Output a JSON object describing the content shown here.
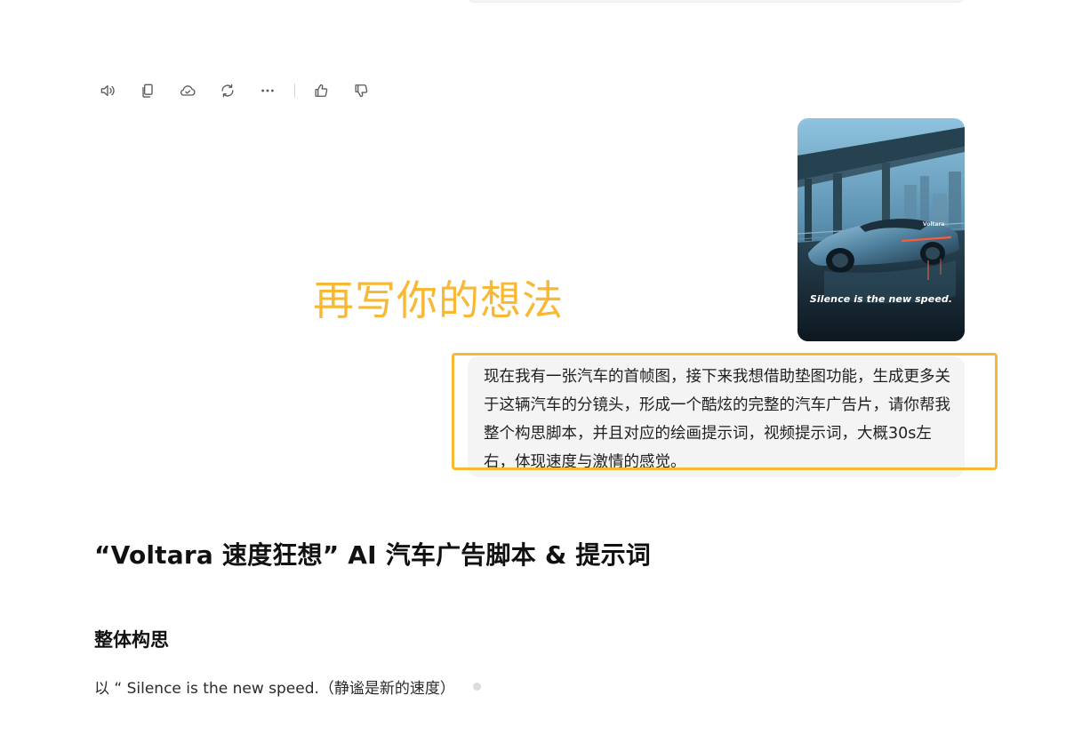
{
  "toolbar": {
    "icons": [
      "speaker-icon",
      "copy-icon",
      "cloud-check-icon",
      "refresh-icon",
      "more-icon",
      "thumbs-up-icon",
      "thumbs-down-icon"
    ]
  },
  "attachment": {
    "brand_text": "Voltara",
    "caption": "Silence is the new speed."
  },
  "annotation": {
    "text": "再写你的想法",
    "color": "#f8b833"
  },
  "user_message": {
    "text": "现在我有一张汽车的首帧图，接下来我想借助垫图功能，生成更多关于这辆汽车的分镜头，形成一个酷炫的完整的汽车广告片，请你帮我整个构思脚本，并且对应的绘画提示词，视频提示词，大概30s左右，体现速度与激情的感觉。"
  },
  "response": {
    "title": "“Voltara 速度狂想” AI 汽车广告脚本 & 提示词",
    "section_heading": "整体构思",
    "paragraph": "以 “ Silence is the new speed.（静谧是新的速度）"
  },
  "colors": {
    "highlight": "#f8b833",
    "bubble_bg": "#f4f4f4",
    "icon": "#5b5b5b"
  }
}
